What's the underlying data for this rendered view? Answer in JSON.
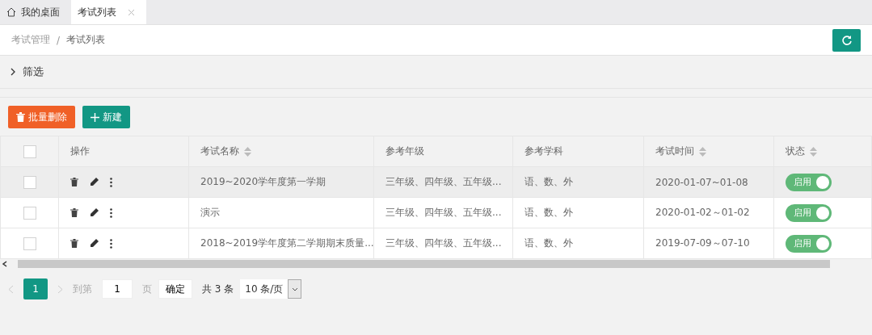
{
  "tabs": [
    {
      "label": "我的桌面",
      "kind": "home",
      "selected": false
    },
    {
      "label": "考试列表",
      "kind": "closable",
      "selected": true
    }
  ],
  "breadcrumb": [
    "考试管理",
    "/",
    "考试列表"
  ],
  "filter": {
    "label": "筛选",
    "expanded": false
  },
  "toolbar": [
    {
      "label": "批量删除",
      "kind": "danger"
    },
    {
      "label": "新建",
      "kind": "primary"
    }
  ],
  "table": {
    "select_all_checked": false,
    "columns": [
      {
        "label": "操作",
        "sortable": false
      },
      {
        "label": "考试名称",
        "sortable": true
      },
      {
        "label": "参考年级",
        "sortable": false
      },
      {
        "label": "参考学科",
        "sortable": false
      },
      {
        "label": "考试时间",
        "sortable": true
      },
      {
        "label": "状态",
        "sortable": true
      }
    ],
    "rows": [
      {
        "checked": false,
        "hover": true,
        "name": "2019~2020学年度第一学期",
        "grades": "三年级、四年级、五年级...",
        "subjects": "语、数、外",
        "time": "2020-01-07~01-08",
        "status": "启用",
        "on": true
      },
      {
        "checked": false,
        "hover": false,
        "name": "演示",
        "grades": "三年级、四年级、五年级...",
        "subjects": "语、数、外",
        "time": "2020-01-02～01-02",
        "status": "启用",
        "on": true
      },
      {
        "checked": false,
        "hover": false,
        "name": "2018~2019学年度第二学期期末质量...",
        "grades": "三年级、四年级、五年级...",
        "subjects": "语、数、外",
        "time": "2019-07-09～07-10",
        "status": "启用",
        "on": true
      }
    ]
  },
  "pager": {
    "pages": [
      {
        "label": "1",
        "selected": true
      }
    ],
    "goto_label": "到第",
    "goto_value": "1",
    "page_unit": "页",
    "confirm": "确定",
    "total": "共 3 条",
    "page_size": "10 条/页"
  }
}
